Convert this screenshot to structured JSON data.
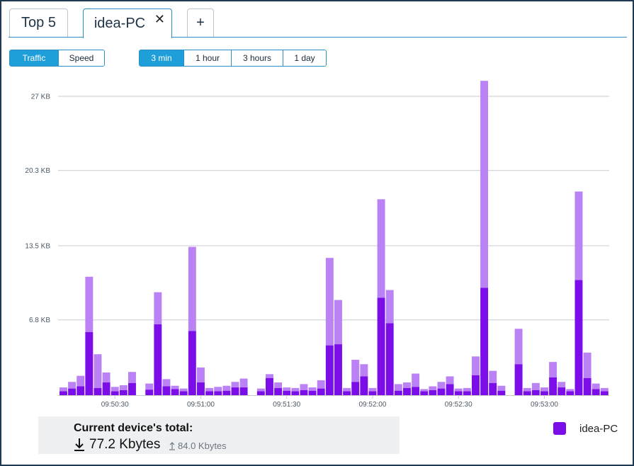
{
  "tabs": [
    {
      "label": "Top 5"
    },
    {
      "label": "idea-PC",
      "close": "✕"
    },
    {
      "label": "+"
    }
  ],
  "metric_toggle": [
    {
      "label": "Traffic",
      "active": true
    },
    {
      "label": "Speed",
      "active": false
    }
  ],
  "range_toggle": [
    {
      "label": "3 min",
      "active": true
    },
    {
      "label": "1 hour",
      "active": false
    },
    {
      "label": "3 hours",
      "active": false
    },
    {
      "label": "1 day",
      "active": false
    }
  ],
  "colors": {
    "accent": "#1e9fd9",
    "download": "#7b0ee8",
    "upload": "#bb82f5"
  },
  "chart_data": {
    "type": "bar",
    "stacked": true,
    "y_ticks": [
      "27 KB",
      "20.3 KB",
      "13.5 KB",
      "6.8 KB"
    ],
    "y_tick_values": [
      27,
      20.3,
      13.5,
      6.8
    ],
    "ylim": [
      0,
      27
    ],
    "x_ticks": [
      "09:50:30",
      "09:51:00",
      "09:51:30",
      "09:52:00",
      "09:52:30",
      "09:53:00"
    ],
    "x_tick_indices": [
      6,
      16,
      26,
      36,
      46,
      56
    ],
    "series": [
      {
        "name": "idea-PC",
        "download": [
          0.35,
          0.6,
          0.8,
          5.7,
          0.65,
          1.15,
          0.35,
          0.45,
          1.1,
          null,
          0.5,
          6.4,
          0.8,
          0.55,
          0.35,
          5.8,
          1.15,
          0.35,
          0.35,
          0.4,
          0.7,
          0.7,
          null,
          0.35,
          1.55,
          0.65,
          0.4,
          0.35,
          0.45,
          0.4,
          0.6,
          4.5,
          4.6,
          0.35,
          1.2,
          1.7,
          0.35,
          8.8,
          6.5,
          0.4,
          0.65,
          0.75,
          0.35,
          0.45,
          0.6,
          1.0,
          0.35,
          0.35,
          1.8,
          9.7,
          1.1,
          0.4,
          null,
          2.8,
          0.35,
          0.45,
          0.35,
          1.6,
          0.7,
          0.35,
          10.4,
          1.55,
          0.55,
          0.35
        ],
        "upload": [
          0.35,
          0.6,
          0.95,
          5.0,
          3.05,
          0.9,
          0.4,
          0.45,
          1.0,
          null,
          0.55,
          2.9,
          0.65,
          0.3,
          0.25,
          7.6,
          1.35,
          0.3,
          0.4,
          0.45,
          0.5,
          0.8,
          null,
          0.25,
          0.35,
          0.5,
          0.3,
          0.3,
          0.55,
          0.3,
          0.75,
          7.9,
          4.0,
          0.3,
          2.0,
          1.1,
          0.3,
          8.9,
          3.0,
          0.6,
          0.5,
          1.2,
          0.2,
          0.35,
          0.6,
          0.7,
          0.25,
          0.3,
          1.7,
          18.7,
          1.1,
          0.45,
          null,
          3.2,
          0.3,
          0.65,
          0.35,
          1.4,
          0.5,
          0.2,
          8.0,
          2.3,
          0.5,
          0.3
        ]
      }
    ]
  },
  "total": {
    "title": "Current device's total:",
    "download_value": "77.2 Kbytes",
    "upload_value": "84.0 Kbytes"
  },
  "legend": {
    "label": "idea-PC"
  }
}
